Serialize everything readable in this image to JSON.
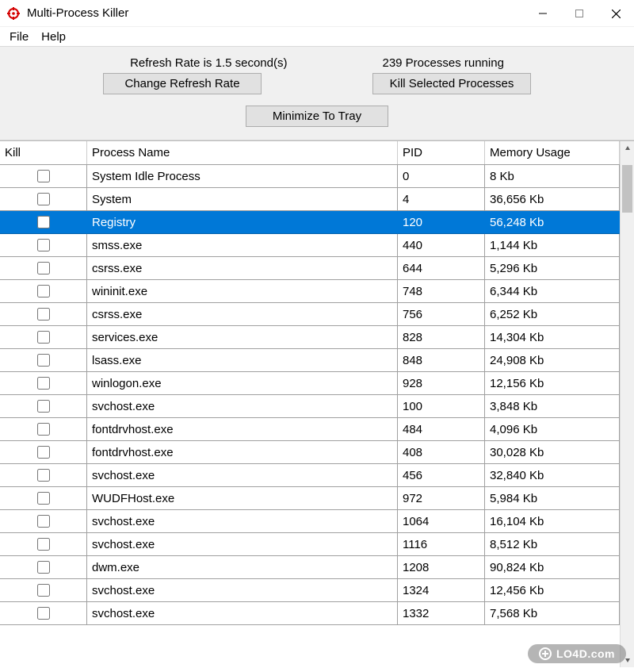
{
  "window": {
    "title": "Multi-Process Killer"
  },
  "menu": {
    "file": "File",
    "help": "Help"
  },
  "toolbar": {
    "refresh_label": "Refresh Rate is 1.5 second(s)",
    "process_count_label": "239 Processes running",
    "change_refresh": "Change Refresh Rate",
    "kill_selected": "Kill Selected Processes",
    "minimize_tray": "Minimize To Tray"
  },
  "columns": {
    "kill": "Kill",
    "name": "Process Name",
    "pid": "PID",
    "mem": "Memory Usage"
  },
  "selected_index": 2,
  "processes": [
    {
      "name": "System Idle Process",
      "pid": "0",
      "mem": "8 Kb"
    },
    {
      "name": "System",
      "pid": "4",
      "mem": "36,656 Kb"
    },
    {
      "name": "Registry",
      "pid": "120",
      "mem": "56,248 Kb"
    },
    {
      "name": "smss.exe",
      "pid": "440",
      "mem": "1,144 Kb"
    },
    {
      "name": "csrss.exe",
      "pid": "644",
      "mem": "5,296 Kb"
    },
    {
      "name": "wininit.exe",
      "pid": "748",
      "mem": "6,344 Kb"
    },
    {
      "name": "csrss.exe",
      "pid": "756",
      "mem": "6,252 Kb"
    },
    {
      "name": "services.exe",
      "pid": "828",
      "mem": "14,304 Kb"
    },
    {
      "name": "lsass.exe",
      "pid": "848",
      "mem": "24,908 Kb"
    },
    {
      "name": "winlogon.exe",
      "pid": "928",
      "mem": "12,156 Kb"
    },
    {
      "name": "svchost.exe",
      "pid": "100",
      "mem": "3,848 Kb"
    },
    {
      "name": "fontdrvhost.exe",
      "pid": "484",
      "mem": "4,096 Kb"
    },
    {
      "name": "fontdrvhost.exe",
      "pid": "408",
      "mem": "30,028 Kb"
    },
    {
      "name": "svchost.exe",
      "pid": "456",
      "mem": "32,840 Kb"
    },
    {
      "name": "WUDFHost.exe",
      "pid": "972",
      "mem": "5,984 Kb"
    },
    {
      "name": "svchost.exe",
      "pid": "1064",
      "mem": "16,104 Kb"
    },
    {
      "name": "svchost.exe",
      "pid": "1116",
      "mem": "8,512 Kb"
    },
    {
      "name": "dwm.exe",
      "pid": "1208",
      "mem": "90,824 Kb"
    },
    {
      "name": "svchost.exe",
      "pid": "1324",
      "mem": "12,456 Kb"
    },
    {
      "name": "svchost.exe",
      "pid": "1332",
      "mem": "7,568 Kb"
    }
  ],
  "watermark": "LO4D.com"
}
